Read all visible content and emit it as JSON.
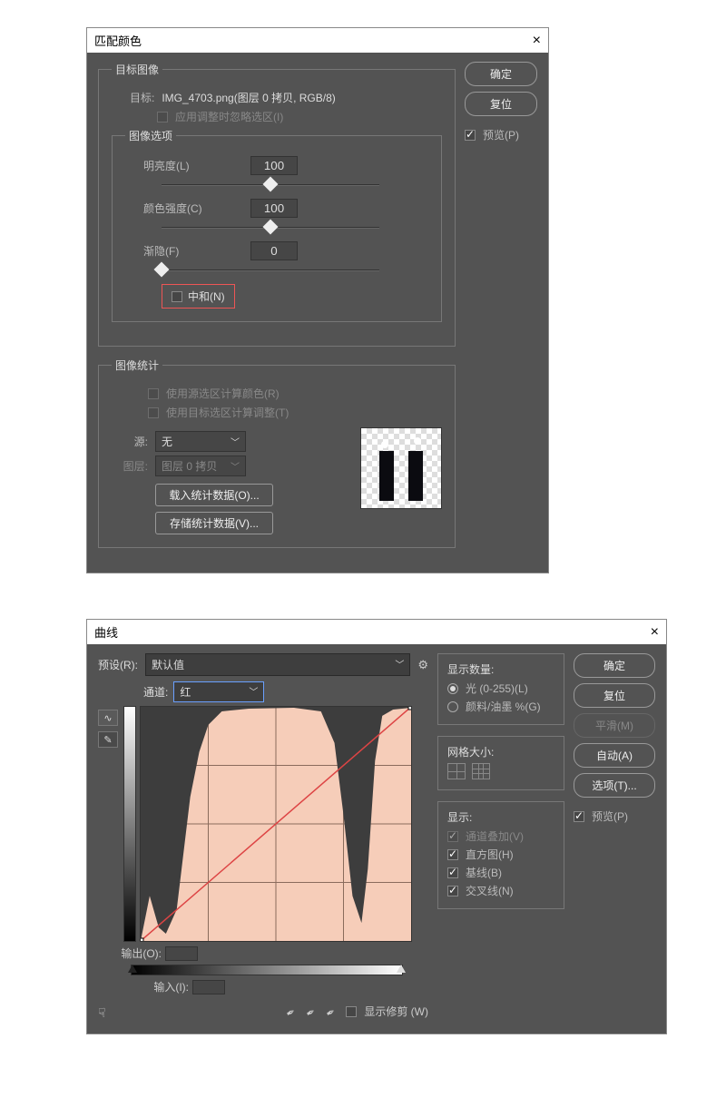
{
  "match": {
    "title": "匹配颜色",
    "target_group": "目标图像",
    "target_label": "目标:",
    "target_value": "IMG_4703.png(图层 0 拷贝, RGB/8)",
    "ignore_sel": "应用调整时忽略选区(I)",
    "img_options": "图像选项",
    "luminance_label": "明亮度(L)",
    "luminance_value": "100",
    "color_label": "颜色强度(C)",
    "color_value": "100",
    "fade_label": "渐隐(F)",
    "fade_value": "0",
    "neutralize": "中和(N)",
    "stats_group": "图像统计",
    "use_src_sel": "使用源选区计算颜色(R)",
    "use_tgt_sel": "使用目标选区计算调整(T)",
    "source_label": "源:",
    "source_value": "无",
    "layer_label": "图层:",
    "layer_value": "图层 0 拷贝",
    "load_stats": "载入统计数据(O)...",
    "save_stats": "存储统计数据(V)...",
    "ok": "确定",
    "reset": "复位",
    "preview": "预览(P)"
  },
  "curves": {
    "title": "曲线",
    "preset_label": "预设(R):",
    "preset_value": "默认值",
    "channel_label": "通道:",
    "channel_value": "红",
    "output_label": "输出(O):",
    "input_label": "输入(I):",
    "show_clip": "显示修剪 (W)",
    "disp_amount": "显示数量:",
    "light": "光 (0-255)(L)",
    "pigment": "颜料/油墨 %(G)",
    "grid_size": "网格大小:",
    "show": "显示:",
    "chan_overlay": "通道叠加(V)",
    "histogram": "直方图(H)",
    "baseline": "基线(B)",
    "intersection": "交叉线(N)",
    "ok": "确定",
    "reset": "复位",
    "smooth": "平滑(M)",
    "auto": "自动(A)",
    "options": "选项(T)...",
    "preview": "预览(P)"
  }
}
